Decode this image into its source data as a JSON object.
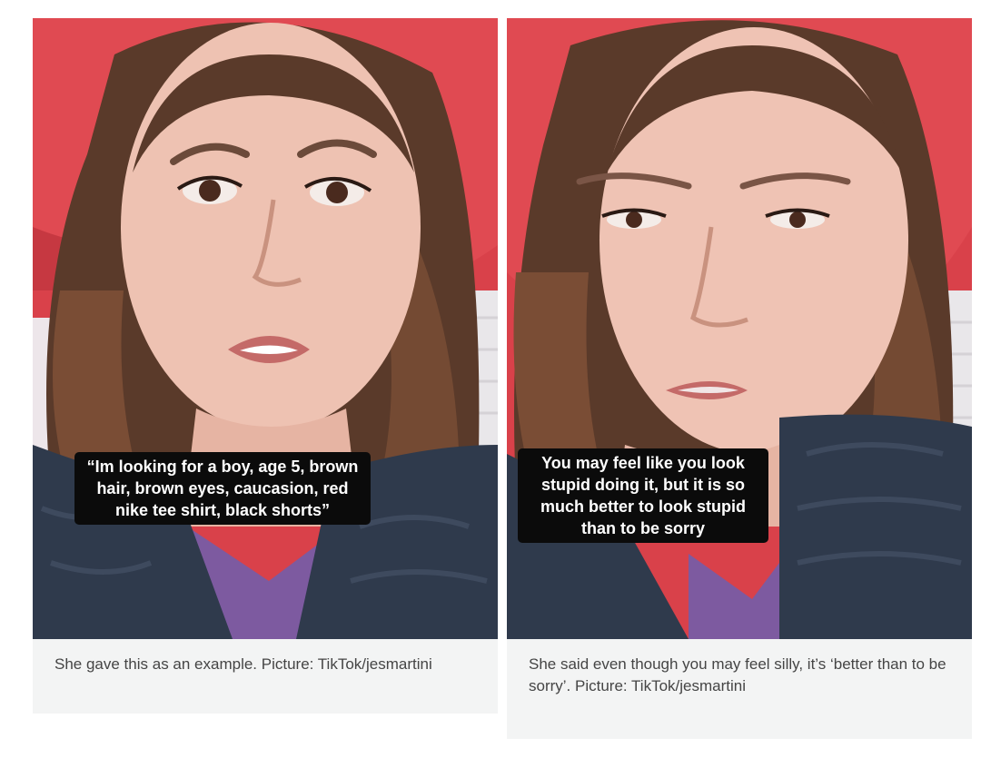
{
  "figures": [
    {
      "subtitle": "“Im looking for a boy, age 5, brown hair, brown eyes, caucasion, red nike tee shirt, black shorts”",
      "caption": "She gave this as an example. Picture: TikTok/jesmartini"
    },
    {
      "subtitle": "You may feel like you look stupid doing it, but it is so much better to look stupid than to be sorry",
      "caption": "She said even though you may feel silly, it’s ‘better than to be sorry’. Picture: TikTok/jesmartini"
    }
  ],
  "colors": {
    "awning": "#d9414a",
    "caption_bg": "#f3f4f4",
    "caption_text": "#454545",
    "subtitle_bg": "#0b0b0b"
  }
}
